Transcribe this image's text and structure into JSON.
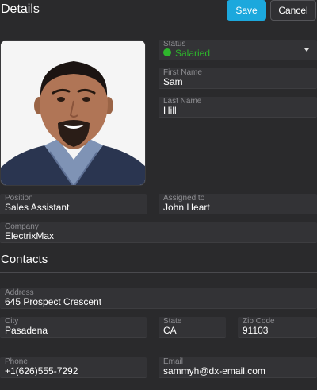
{
  "header": {
    "title": "Details",
    "save_label": "Save",
    "cancel_label": "Cancel"
  },
  "colors": {
    "accent": "#1ca8dd",
    "status_green": "#2eb52c",
    "background": "#2a2a2c"
  },
  "status": {
    "label": "Status",
    "value": "Salaried"
  },
  "first_name": {
    "label": "First Name",
    "value": "Sam"
  },
  "last_name": {
    "label": "Last Name",
    "value": "Hill"
  },
  "position": {
    "label": "Position",
    "value": "Sales Assistant"
  },
  "assigned_to": {
    "label": "Assigned to",
    "value": "John Heart"
  },
  "company": {
    "label": "Company",
    "value": "ElectrixMax"
  },
  "contacts": {
    "title": "Contacts",
    "address": {
      "label": "Address",
      "value": "645 Prospect Crescent"
    },
    "city": {
      "label": "City",
      "value": "Pasadena"
    },
    "state": {
      "label": "State",
      "value": "CA"
    },
    "zip": {
      "label": "Zip Code",
      "value": "91103"
    },
    "phone": {
      "label": "Phone",
      "value": "+1(626)555-7292"
    },
    "email": {
      "label": "Email",
      "value": "sammyh@dx-email.com"
    }
  }
}
